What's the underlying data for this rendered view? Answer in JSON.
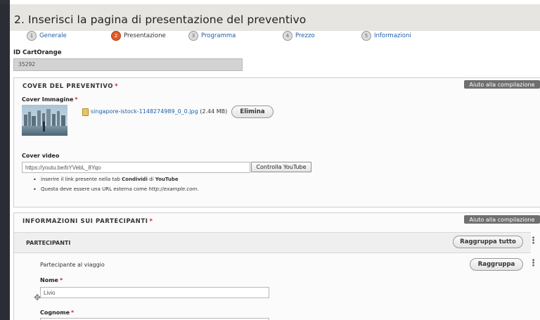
{
  "header": {
    "title": "2. Inserisci la pagina di presentazione del preventivo"
  },
  "steps": [
    {
      "number": "1",
      "label": "Generale",
      "active": false
    },
    {
      "number": "2",
      "label": "Presentazione",
      "active": true
    },
    {
      "number": "3",
      "label": "Programma",
      "active": false
    },
    {
      "number": "4",
      "label": "Prezzo",
      "active": false
    },
    {
      "number": "5",
      "label": "Informazioni",
      "active": false
    }
  ],
  "cart_orange": {
    "label": "ID CartOrange",
    "value": "35292"
  },
  "cover_section": {
    "title": "COVER DEL PREVENTIVO",
    "required_mark": "*",
    "help_button": "Aiuto alla compilazione",
    "image_label": "Cover Immagine",
    "image_required": "*",
    "file_name": "singapore-istock-1148274989_0_0.jpg",
    "file_size": "(2.44 MB)",
    "delete_button": "Elimina",
    "video_label": "Cover video",
    "video_value": "https://youtu.be/bYVebL_8Yqo",
    "check_button": "Controlla YouTube",
    "hint1": {
      "pre": "inserire il link presente nella tab ",
      "bold1": "Condividi",
      "mid": " di ",
      "bold2": "YouTube"
    },
    "hint2": {
      "pre": "Questa deve essere una URL esterna come ",
      "italic": "http://example.com",
      "post": "."
    }
  },
  "participants_section": {
    "title": "INFORMAZIONI SUI PARTECIPANTI",
    "required_mark": "*",
    "help_button": "Aiuto alla compilazione",
    "group_title": "PARTECIPANTI",
    "group_all_button": "Raggruppa tutto",
    "item_title": "Partecipante al viaggio",
    "group_button": "Raggruppa",
    "name_label": "Nome",
    "name_required": "*",
    "name_value": "Livio",
    "surname_label": "Cognome",
    "surname_required": "*"
  },
  "colors": {
    "accent": "#e05a2a",
    "link": "#1c5fa8",
    "required": "#d3212a",
    "help_button": "#6f6f6f"
  },
  "icons": {
    "file": "file-image-icon",
    "kebab": "vertical-dots-icon",
    "drag": "drag-handle-icon"
  }
}
